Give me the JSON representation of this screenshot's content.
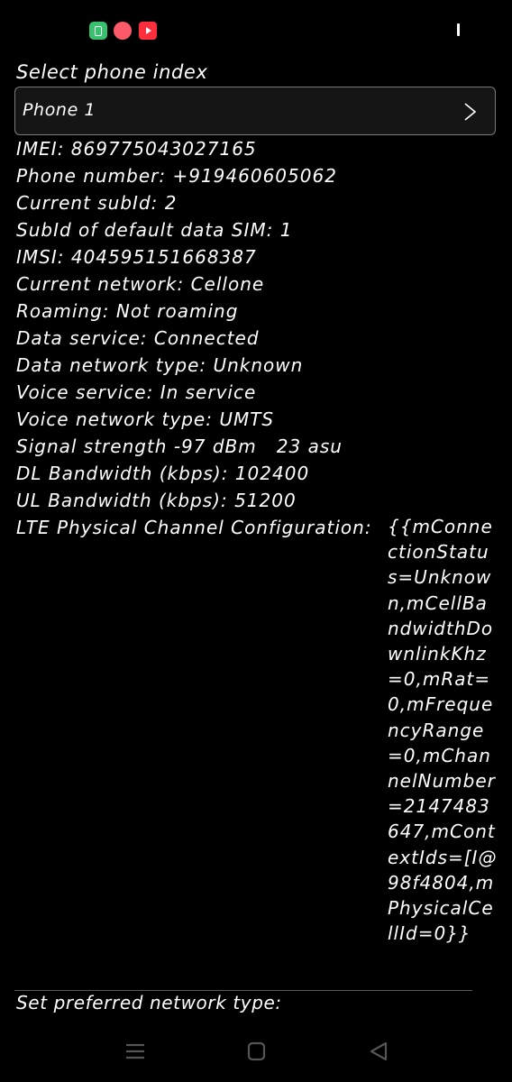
{
  "status_bar": {
    "icons": [
      "app-green-icon",
      "app-red-icon",
      "youtube-icon",
      "signal-indicator-icon"
    ]
  },
  "select_phone": {
    "label": "Select phone index",
    "value": "Phone 1"
  },
  "info": {
    "imei": "IMEI: 869775043027165",
    "phone_number": "Phone number: +919460605062",
    "current_subid": "Current subId: 2",
    "subid_default_data": "SubId of default data SIM: 1",
    "imsi": "IMSI: 404595151668387",
    "current_network": "Current network: Cellone",
    "roaming": "Roaming: Not roaming",
    "data_service": "Data service: Connected",
    "data_network_type": "Data network type: Unknown",
    "voice_service": "Voice service: In service",
    "voice_network_type": "Voice network type: UMTS",
    "signal_strength": "Signal strength -97 dBm   23 asu",
    "dl_bandwidth": "DL Bandwidth (kbps): 102400",
    "ul_bandwidth": "UL Bandwidth (kbps): 51200"
  },
  "lte_config": {
    "key": "LTE Physical Channel Configuration:",
    "value": "{{mConnectionStatus=Unknown,mCellBandwidthDownlinkKhz=0,mRat=0,mFrequencyRange=0,mChannelNumber=2147483647,mContextIds=[I@98f4804,mPhysicalCellId=0}}"
  },
  "preferred_network": {
    "label": "Set preferred network type:"
  },
  "nav": {
    "icons": [
      "recent-apps-icon",
      "home-icon",
      "back-icon"
    ]
  }
}
